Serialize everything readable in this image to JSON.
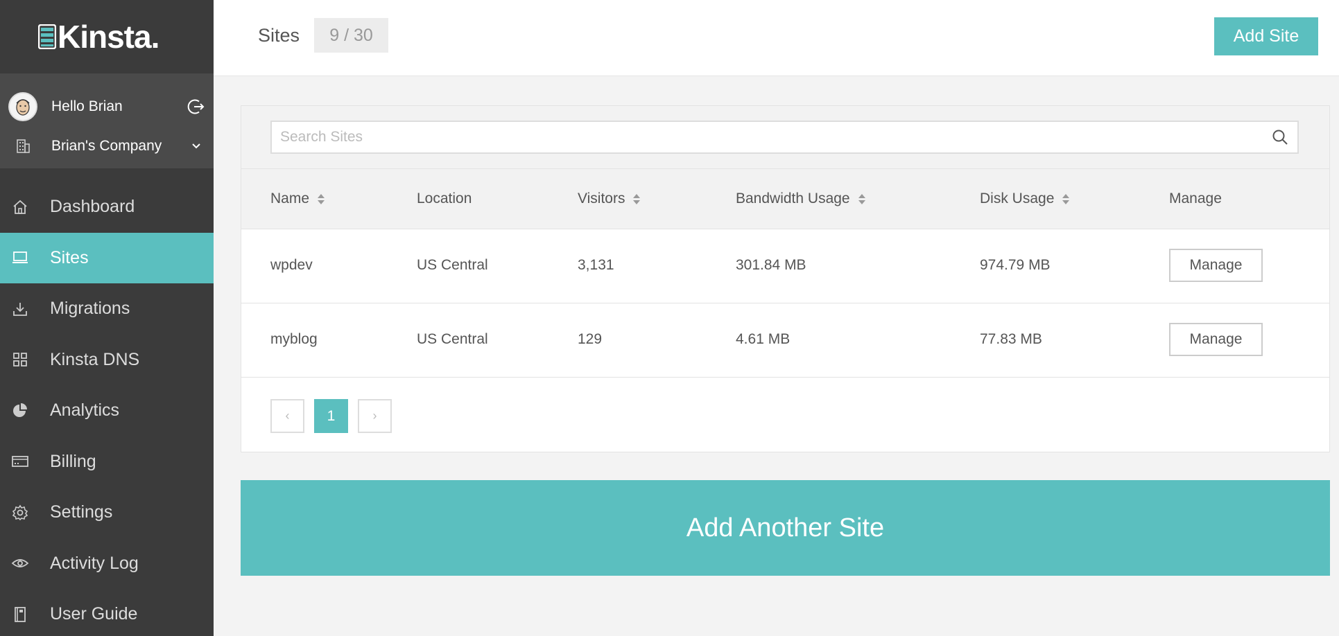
{
  "brand": {
    "logo_text": "Kinsta."
  },
  "user": {
    "greeting": "Hello Brian",
    "company": "Brian's Company"
  },
  "nav": {
    "items": [
      {
        "label": "Dashboard",
        "icon": "home-icon"
      },
      {
        "label": "Sites",
        "icon": "monitor-icon",
        "active": true
      },
      {
        "label": "Migrations",
        "icon": "download-icon"
      },
      {
        "label": "Kinsta DNS",
        "icon": "grid-icon"
      },
      {
        "label": "Analytics",
        "icon": "pie-chart-icon"
      },
      {
        "label": "Billing",
        "icon": "credit-card-icon"
      },
      {
        "label": "Settings",
        "icon": "gear-icon"
      },
      {
        "label": "Activity Log",
        "icon": "eye-icon"
      },
      {
        "label": "User Guide",
        "icon": "book-icon"
      }
    ]
  },
  "header": {
    "title": "Sites",
    "count": "9 / 30",
    "add_site_label": "Add Site"
  },
  "search": {
    "placeholder": "Search Sites"
  },
  "table": {
    "columns": [
      "Name",
      "Location",
      "Visitors",
      "Bandwidth Usage",
      "Disk Usage",
      "Manage"
    ],
    "rows": [
      {
        "name": "wpdev",
        "location": "US Central",
        "visitors": "3,131",
        "bandwidth": "301.84 MB",
        "disk": "974.79 MB",
        "manage": "Manage"
      },
      {
        "name": "myblog",
        "location": "US Central",
        "visitors": "129",
        "bandwidth": "4.61 MB",
        "disk": "77.83 MB",
        "manage": "Manage"
      }
    ]
  },
  "pagination": {
    "prev": "‹",
    "current": "1",
    "next": "›"
  },
  "add_another_label": "Add Another Site",
  "colors": {
    "accent": "#5bbfbf",
    "sidebar": "#3b3b3b",
    "sidebar_user": "#4a4a4a"
  }
}
